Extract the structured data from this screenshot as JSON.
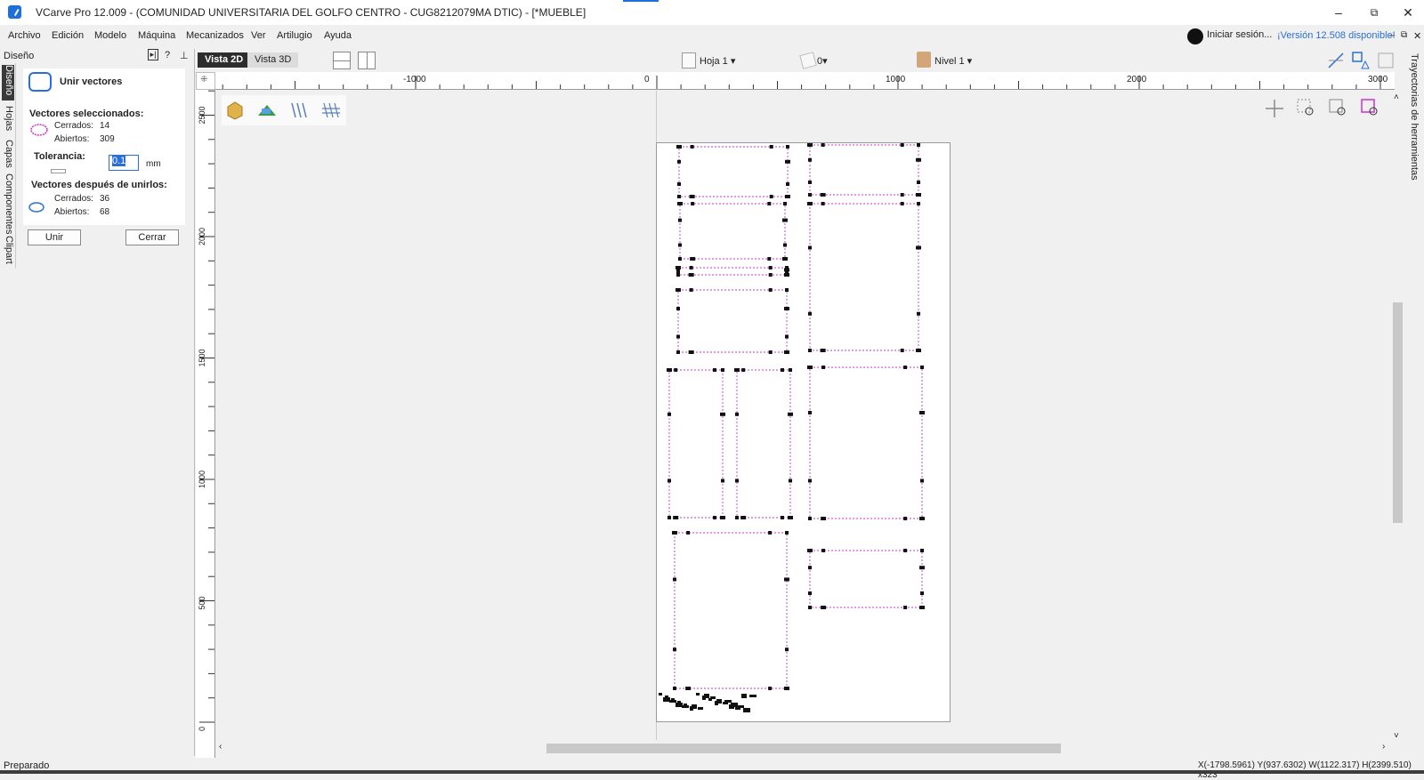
{
  "window": {
    "title": "VCarve Pro 12.009 - (COMUNIDAD UNIVERSITARIA DEL GOLFO CENTRO - CUG8212079MA DTIC) - [*MUEBLE]",
    "minimize": "–",
    "restore": "⧉",
    "close": "✕"
  },
  "menu": [
    "Archivo",
    "Edición",
    "Modelo",
    "Máquina",
    "Mecanizados",
    "Ver",
    "Artilugio",
    "Ayuda"
  ],
  "account": {
    "signin": "Iniciar sesión...",
    "version": "¡Versión 12.508 disponible!"
  },
  "left_tabs": [
    "Diseño",
    "Hojas",
    "Capas",
    "Componentes",
    "Clipart"
  ],
  "panel": {
    "header": "Diseño",
    "title": "Unir vectores",
    "selected_heading": "Vectores seleccionados:",
    "closed_label": "Cerrados:",
    "closed_value": "14",
    "open_label": "Abiertos:",
    "open_value": "309",
    "tolerance_label": "Tolerancia:",
    "tolerance_value": "0.1",
    "tolerance_unit": "mm",
    "after_heading": "Vectores después de unirlos:",
    "after_closed_label": "Cerrados:",
    "after_closed_value": "36",
    "after_open_label": "Abiertos:",
    "after_open_value": "68",
    "join_button": "Unir",
    "close_button": "Cerrar"
  },
  "view": {
    "tab_2d": "Vista 2D",
    "tab_3d": "Vista 3D",
    "sheet": "Hoja 1",
    "layer_count": "0",
    "level": "Nivel 1"
  },
  "ruler": {
    "x_labels": [
      "-1000",
      "0",
      "1000",
      "2000",
      "3000"
    ],
    "y_labels": [
      "2500",
      "2000",
      "1500",
      "1000",
      "500",
      "0"
    ]
  },
  "right_panel_label": "Trayectorias de herramientas",
  "status": {
    "left": "Preparado",
    "right": "X(-1798.5961) Y(937.6302)    W(1122.317) H(2399.510) x323"
  },
  "colors": {
    "accent": "#2a6fd6",
    "vector_magenta": "#cc33cc",
    "node_black": "#111111"
  }
}
